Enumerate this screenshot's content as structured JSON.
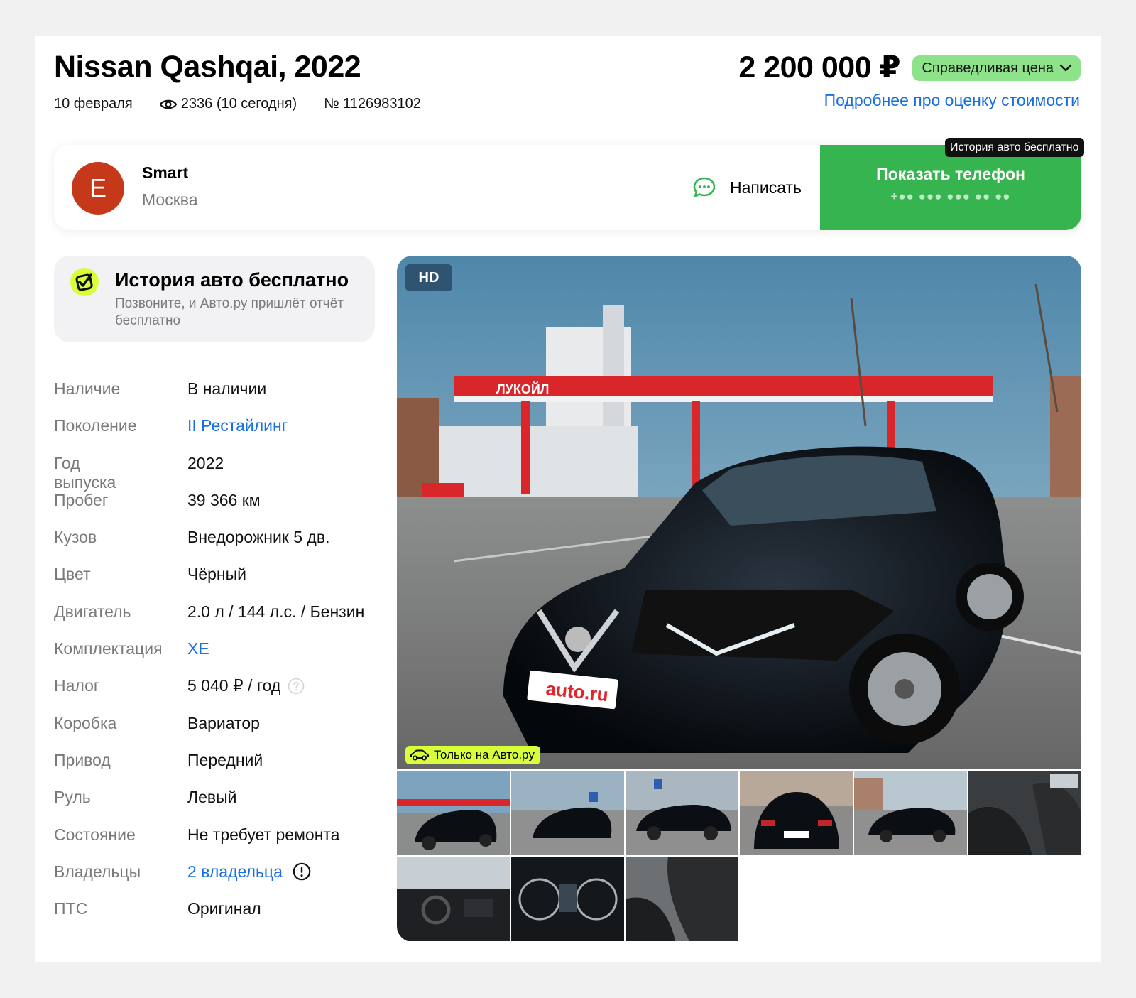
{
  "header": {
    "title": "Nissan Qashqai, 2022",
    "date": "10 февраля",
    "views": "2336 (10 сегодня)",
    "ad_number": "№ 1126983102",
    "price": "2 200 000 ₽",
    "price_badge": "Справедливая цена",
    "price_link": "Подробнее про оценку стоимости"
  },
  "seller": {
    "avatar_letter": "E",
    "name": "Smart",
    "city": "Москва",
    "write_label": "Написать",
    "phone_label": "Показать телефон",
    "phone_mask": "+●● ●●● ●●● ●● ●●",
    "tooltip": "История авто бесплатно"
  },
  "history": {
    "title": "История авто бесплатно",
    "subtitle": "Позвоните, и Авто.ру пришлёт отчёт бесплатно"
  },
  "specs": [
    {
      "key": "Наличие",
      "value": "В наличии"
    },
    {
      "key": "Поколение",
      "value": "II Рестайлинг"
    },
    {
      "key": "Год выпуска",
      "value": "2022"
    },
    {
      "key": "Пробег",
      "value": "39 366 км"
    },
    {
      "key": "Кузов",
      "value": "Внедорожник 5 дв."
    },
    {
      "key": "Цвет",
      "value": "Чёрный"
    },
    {
      "key": "Двигатель",
      "value": "2.0 л / 144 л.с. / Бензин"
    },
    {
      "key": "Комплектация",
      "value": "XE"
    },
    {
      "key": "Налог",
      "value": "5 040 ₽ / год"
    },
    {
      "key": "Коробка",
      "value": "Вариатор"
    },
    {
      "key": "Привод",
      "value": "Передний"
    },
    {
      "key": "Руль",
      "value": "Левый"
    },
    {
      "key": "Состояние",
      "value": "Не требует ремонта"
    },
    {
      "key": "Владельцы",
      "value": "2 владельца"
    },
    {
      "key": "ПТС",
      "value": "Оригинал"
    }
  ],
  "gallery": {
    "hd_badge": "HD",
    "only_badge": "Только на Авто.ру",
    "station_sign": "ЛУКОЙЛ",
    "plate_text": "auto.ru",
    "thumbnails": [
      "front-three-quarter-gas-station",
      "front-parking-lot",
      "side-profile",
      "rear-view",
      "side-street",
      "front-seats-interior",
      "dashboard-interior",
      "instrument-cluster",
      "rear-seats-interior"
    ]
  },
  "colors": {
    "accent_green": "#36b44f",
    "badge_green": "#8ee38a",
    "link_blue": "#1a6fe0",
    "avatar_red": "#c5391a",
    "history_badge_lime": "#d9ff3a"
  }
}
